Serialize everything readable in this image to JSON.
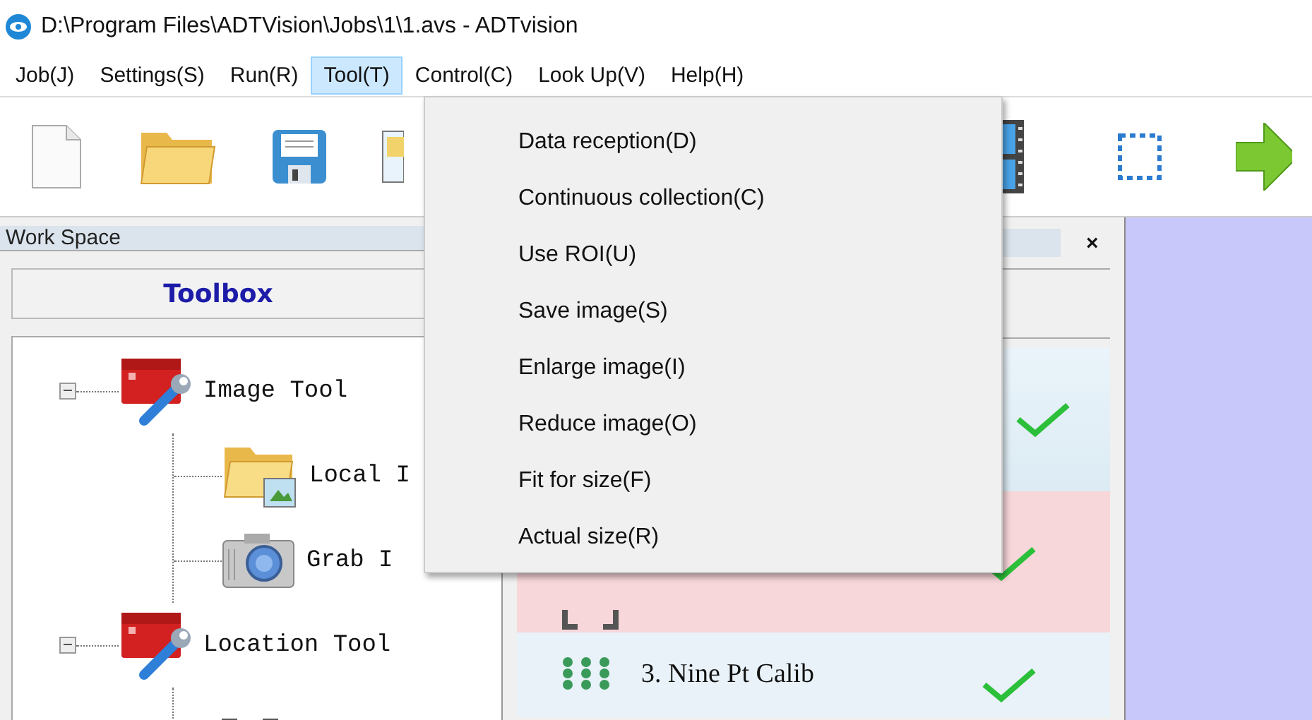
{
  "window": {
    "title": "D:\\Program Files\\ADTVision\\Jobs\\1\\1.avs - ADTvision"
  },
  "menu_bar": [
    {
      "label": "Job(J)",
      "selected": false
    },
    {
      "label": "Settings(S)",
      "selected": false
    },
    {
      "label": "Run(R)",
      "selected": false
    },
    {
      "label": "Tool(T)",
      "selected": true
    },
    {
      "label": "Control(C)",
      "selected": false
    },
    {
      "label": "Look Up(V)",
      "selected": false
    },
    {
      "label": "Help(H)",
      "selected": false
    }
  ],
  "dropdown": {
    "items": [
      "Data reception(D)",
      "Continuous collection(C)",
      "Use ROI(U)",
      "Save image(S)",
      "Enlarge image(I)",
      "Reduce image(O)",
      "Fit for size(F)",
      "Actual size(R)"
    ]
  },
  "workspace": {
    "title": "Work Space",
    "close": "×",
    "toolbox_button": "Toolbox",
    "tree": [
      {
        "label": "Image Tool",
        "kind": "group",
        "expanded": true,
        "children": [
          {
            "label": "Local I",
            "kind": "folder"
          },
          {
            "label": "Grab I",
            "kind": "camera"
          }
        ]
      },
      {
        "label": "Location Tool",
        "kind": "group",
        "expanded": true,
        "children": [
          {
            "kind": "region"
          }
        ]
      }
    ]
  },
  "job_steps": [
    {
      "kind": "blank",
      "selected": false,
      "passed": true
    },
    {
      "kind": "region",
      "selected": true,
      "passed": true
    },
    {
      "kind": "grid",
      "label": "3. Nine Pt Calib",
      "selected": false,
      "passed": true
    }
  ]
}
